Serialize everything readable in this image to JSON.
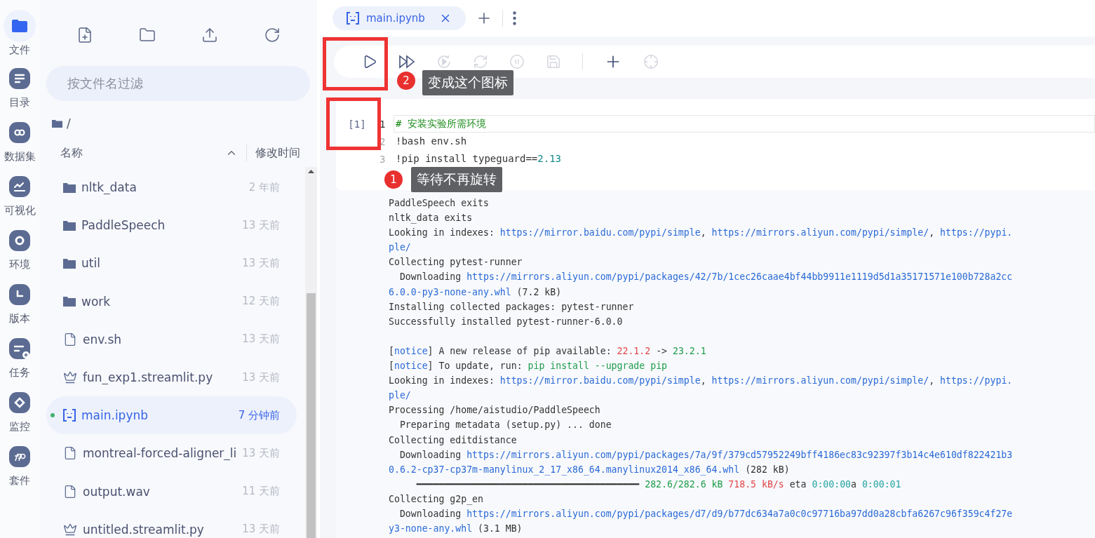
{
  "rail": [
    {
      "label": "文件",
      "kind": "folder",
      "selected": true
    },
    {
      "label": "目录",
      "kind": "list",
      "selected": false
    },
    {
      "label": "数据集",
      "kind": "link",
      "selected": false
    },
    {
      "label": "可视化",
      "kind": "chart",
      "selected": false
    },
    {
      "label": "环境",
      "kind": "ring",
      "selected": false
    },
    {
      "label": "版本",
      "kind": "clock",
      "selected": false
    },
    {
      "label": "任务",
      "kind": "task",
      "selected": false
    },
    {
      "label": "监控",
      "kind": "diamond",
      "selected": false
    },
    {
      "label": "套件",
      "kind": "suite",
      "selected": false
    }
  ],
  "file_panel": {
    "search": {
      "placeholder": "按文件名过滤"
    },
    "path": "/",
    "columns": [
      {
        "label": "名称",
        "sorted": true
      },
      {
        "label": "修改时间",
        "sorted": false
      }
    ],
    "files": [
      {
        "kind": "folder",
        "name": "nltk_data",
        "time": "2 年前",
        "selected": false,
        "running": false
      },
      {
        "kind": "folder",
        "name": "PaddleSpeech",
        "time": "13 天前",
        "selected": false,
        "running": false
      },
      {
        "kind": "folder",
        "name": "util",
        "time": "13 天前",
        "selected": false,
        "running": false
      },
      {
        "kind": "folder",
        "name": "work",
        "time": "12 天前",
        "selected": false,
        "running": false
      },
      {
        "kind": "file",
        "name": "env.sh",
        "time": "13 天前",
        "selected": false,
        "running": false
      },
      {
        "kind": "crown",
        "name": "fun_exp1.streamlit.py",
        "time": "13 天前",
        "selected": false,
        "running": false
      },
      {
        "kind": "notebook",
        "name": "main.ipynb",
        "time": "7 分钟前",
        "selected": true,
        "running": true
      },
      {
        "kind": "file",
        "name": "montreal-forced-aligner_li",
        "time": "13 天前",
        "selected": false,
        "running": false
      },
      {
        "kind": "file",
        "name": "output.wav",
        "time": "11 天前",
        "selected": false,
        "running": false
      },
      {
        "kind": "crown",
        "name": "untitled.streamlit.py",
        "time": "13 天前",
        "selected": false,
        "running": false
      }
    ]
  },
  "tabs": [
    {
      "label": "main.ipynb",
      "selected": true
    }
  ],
  "toolbar": [
    {
      "kind": "run",
      "disabled": false
    },
    {
      "kind": "run-all",
      "disabled": false
    },
    {
      "kind": "restart-run",
      "disabled": true
    },
    {
      "kind": "restart",
      "disabled": true
    },
    {
      "kind": "stop",
      "disabled": true
    },
    {
      "kind": "save",
      "disabled": true
    },
    {
      "kind": "divider"
    },
    {
      "kind": "add",
      "disabled": false
    },
    {
      "kind": "locate",
      "disabled": true
    }
  ],
  "cell": {
    "prompt": "[1]",
    "code": [
      {
        "number": "1",
        "segments": [
          {
            "kind": "comment",
            "text": "# 安装实验所需环境"
          }
        ]
      },
      {
        "number": "2",
        "segments": [
          {
            "kind": "plain",
            "text": "!bash env.sh"
          }
        ]
      },
      {
        "number": "3",
        "segments": [
          {
            "kind": "plain",
            "text": "!pip install typeguard=="
          },
          {
            "kind": "number",
            "text": "2.13"
          }
        ]
      }
    ],
    "output": [
      [
        [
          {
            "kind": "plain",
            "text": "PaddleSpeech exits"
          }
        ],
        [
          {
            "kind": "plain",
            "text": "nltk_data exits"
          }
        ],
        [
          {
            "kind": "plain",
            "text": "Looking in indexes: "
          },
          {
            "kind": "link",
            "text": "https://mirror.baidu.com/pypi/simple"
          },
          {
            "kind": "plain",
            "text": ", "
          },
          {
            "kind": "link",
            "text": "https://mirrors.aliyun.com/pypi/simple/"
          },
          {
            "kind": "plain",
            "text": ", "
          },
          {
            "kind": "link",
            "text": "https://pypi."
          }
        ],
        [
          {
            "kind": "link",
            "text": "ple/"
          }
        ],
        [
          {
            "kind": "plain",
            "text": "Collecting pytest-runner"
          }
        ],
        [
          {
            "kind": "plain",
            "text": "  Downloading "
          },
          {
            "kind": "link",
            "text": "https://mirrors.aliyun.com/pypi/packages/42/7b/1cec26caae4bf44bb9911e1119d5d1a35171571e100b728a2cc"
          }
        ],
        [
          {
            "kind": "link",
            "text": "6.0.0-py3-none-any.whl"
          },
          {
            "kind": "plain",
            "text": " (7.2 kB)"
          }
        ],
        [
          {
            "kind": "plain",
            "text": "Installing collected packages: pytest-runner"
          }
        ],
        [
          {
            "kind": "plain",
            "text": "Successfully installed pytest-runner-6.0.0"
          }
        ]
      ],
      [
        [
          {
            "kind": "plain",
            "text": "["
          },
          {
            "kind": "link",
            "text": "notice"
          },
          {
            "kind": "plain",
            "text": "] A new release of pip available: "
          },
          {
            "kind": "red",
            "text": "22.1.2"
          },
          {
            "kind": "plain",
            "text": " -> "
          },
          {
            "kind": "green",
            "text": "23.2.1"
          }
        ],
        [
          {
            "kind": "plain",
            "text": "["
          },
          {
            "kind": "link",
            "text": "notice"
          },
          {
            "kind": "plain",
            "text": "] To update, run: "
          },
          {
            "kind": "green",
            "text": "pip install --upgrade pip"
          }
        ],
        [
          {
            "kind": "plain",
            "text": "Looking in indexes: "
          },
          {
            "kind": "link",
            "text": "https://mirror.baidu.com/pypi/simple"
          },
          {
            "kind": "plain",
            "text": ", "
          },
          {
            "kind": "link",
            "text": "https://mirrors.aliyun.com/pypi/simple/"
          },
          {
            "kind": "plain",
            "text": ", "
          },
          {
            "kind": "link",
            "text": "https://pypi."
          }
        ],
        [
          {
            "kind": "link",
            "text": "ple/"
          }
        ],
        [
          {
            "kind": "plain",
            "text": "Processing /home/aistudio/PaddleSpeech"
          }
        ],
        [
          {
            "kind": "plain",
            "text": "  Preparing metadata (setup.py) ... done"
          }
        ],
        [
          {
            "kind": "plain",
            "text": "Collecting editdistance"
          }
        ],
        [
          {
            "kind": "plain",
            "text": "  Downloading "
          },
          {
            "kind": "link",
            "text": "https://mirrors.aliyun.com/pypi/packages/7a/9f/379cd57952249bff4186ec83c92397f3b14c4e610df822421b3"
          }
        ],
        [
          {
            "kind": "link",
            "text": "0.6.2-cp37-cp37m-manylinux_2_17_x86_64.manylinux2014_x86_64.whl"
          },
          {
            "kind": "plain",
            "text": " (282 kB)"
          }
        ],
        [
          {
            "kind": "plain",
            "text": "     ━━━━━━━━━━━━━━━━━━━━━━━━━━━━━━━━━━━━━━━━ "
          },
          {
            "kind": "green",
            "text": "282.6/282.6 kB"
          },
          {
            "kind": "red",
            "text": " 718.5 kB/s"
          },
          {
            "kind": "plain",
            "text": " eta "
          },
          {
            "kind": "cyan",
            "text": "0:00:00"
          },
          {
            "kind": "plain",
            "text": "a "
          },
          {
            "kind": "cyan",
            "text": "0:00:01"
          }
        ],
        [
          {
            "kind": "plain",
            "text": "Collecting g2p_en"
          }
        ],
        [
          {
            "kind": "plain",
            "text": "  Downloading "
          },
          {
            "kind": "link",
            "text": "https://mirrors.aliyun.com/pypi/packages/d7/d9/b77dc634a7a0c0c97716ba97dd0a28cbfa6267c96f359c4f27e"
          }
        ],
        [
          {
            "kind": "link",
            "text": "y3-none-any.whl"
          },
          {
            "kind": "plain",
            "text": " (3.1 MB)"
          }
        ]
      ]
    ]
  },
  "annotations": [
    {
      "number": "2",
      "text": "变成这个图标"
    },
    {
      "number": "1",
      "text": "等待不再旋转"
    }
  ]
}
